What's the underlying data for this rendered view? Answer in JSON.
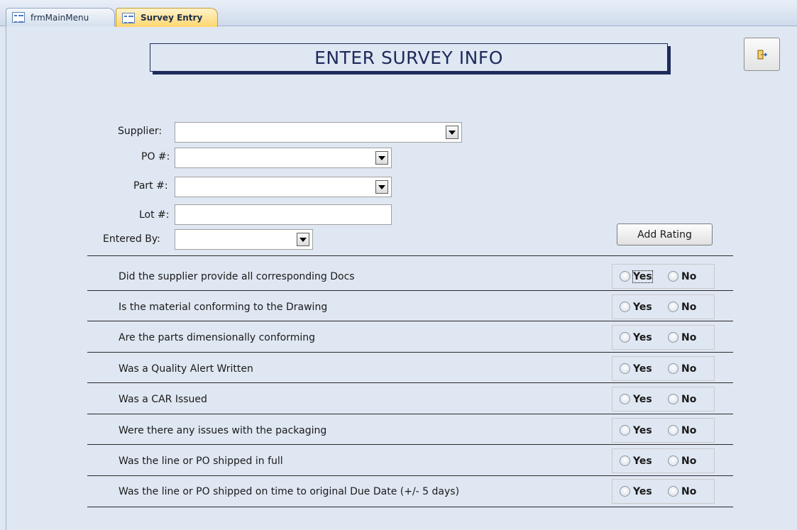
{
  "tabs": [
    {
      "label": "frmMainMenu",
      "active": false
    },
    {
      "label": "Survey Entry",
      "active": true
    }
  ],
  "header": {
    "title": "ENTER SURVEY INFO",
    "exit_icon": "exit-door-icon"
  },
  "fields": {
    "supplier": {
      "label": "Supplier:",
      "value": ""
    },
    "po": {
      "label": "PO #:",
      "value": ""
    },
    "part": {
      "label": "Part #:",
      "value": ""
    },
    "lot": {
      "label": "Lot #:",
      "value": ""
    },
    "entered_by": {
      "label": "Entered By:",
      "value": ""
    }
  },
  "add_rating_label": "Add Rating",
  "option_labels": {
    "yes": "Yes",
    "no": "No"
  },
  "questions": [
    {
      "text": "Did the supplier provide all corresponding Docs",
      "selected": null
    },
    {
      "text": "Is the material conforming to the Drawing",
      "selected": null
    },
    {
      "text": "Are the parts dimensionally conforming",
      "selected": null
    },
    {
      "text": "Was a Quality Alert Written",
      "selected": null
    },
    {
      "text": "Was a CAR Issued",
      "selected": null
    },
    {
      "text": "Were there any issues with the packaging",
      "selected": null
    },
    {
      "text": "Was the line or PO shipped in full",
      "selected": null
    },
    {
      "text": "Was the line or PO shipped on time to original Due Date (+/- 5 days)",
      "selected": null
    }
  ],
  "colors": {
    "form_background": "#dfe7f2",
    "active_tab": "#ffd66e",
    "title_border": "#1f2a5c"
  }
}
